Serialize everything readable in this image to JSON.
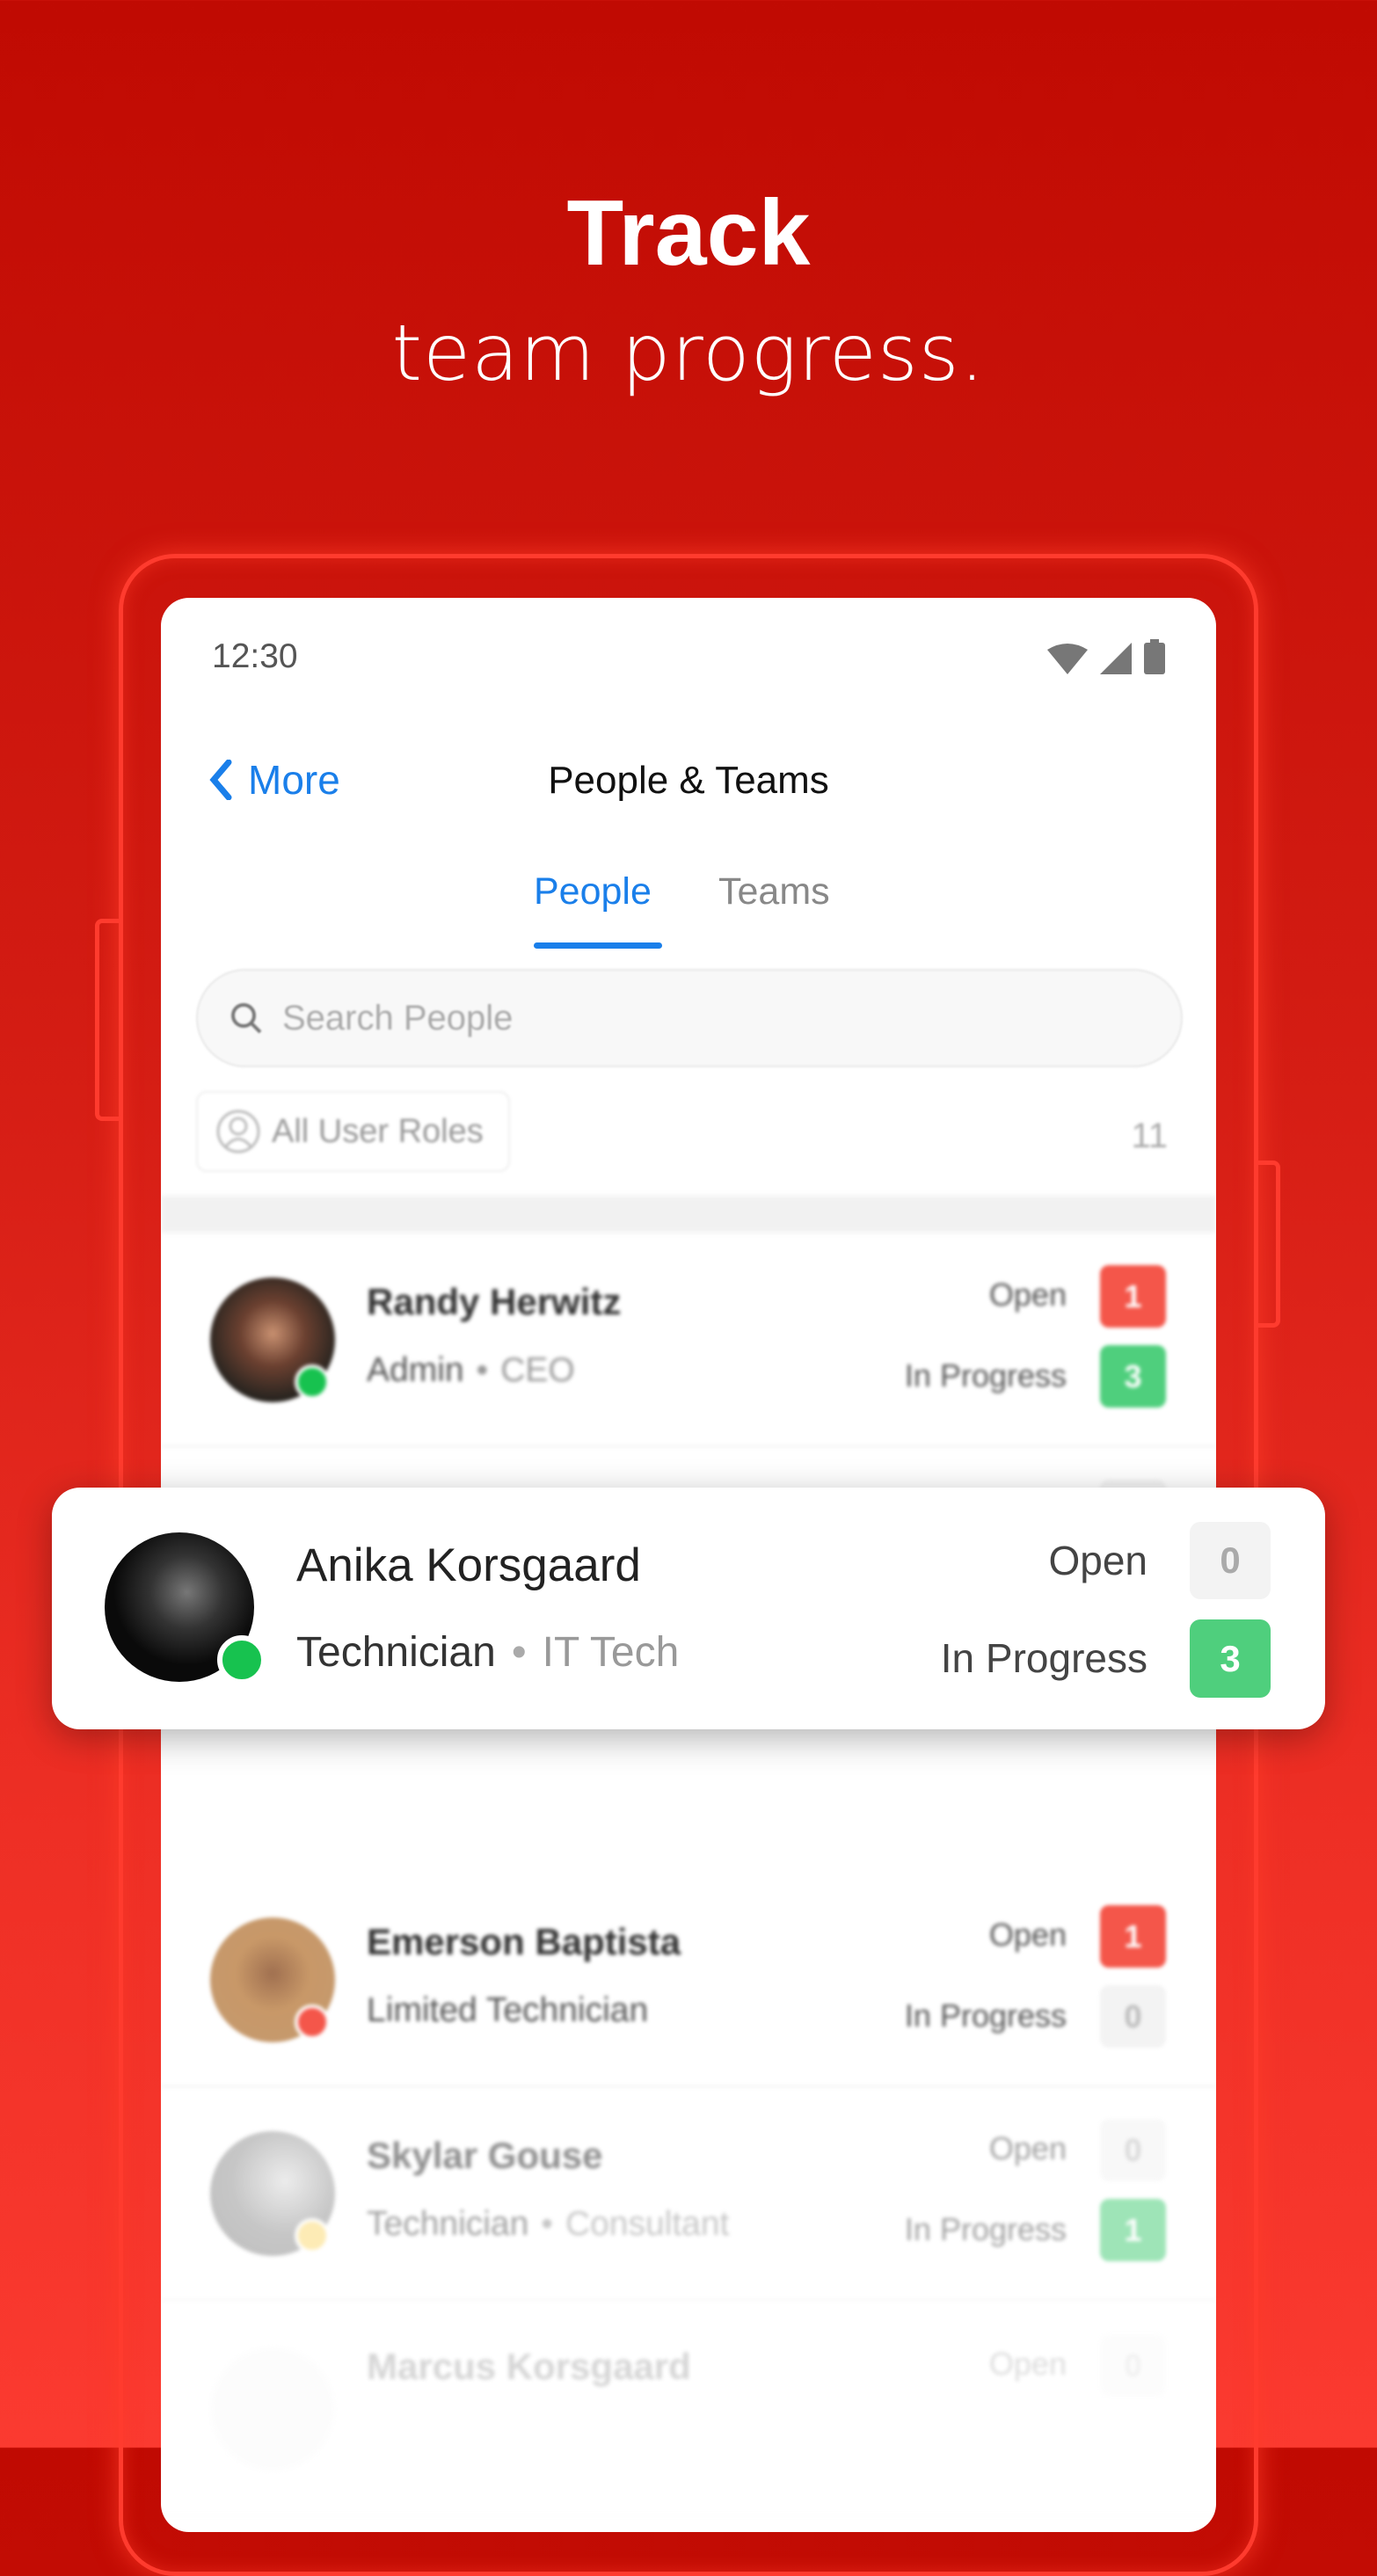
{
  "hero": {
    "title": "Track",
    "subtitle": "team progress."
  },
  "status_bar": {
    "time": "12:30",
    "icons": [
      "wifi-icon",
      "signal-icon",
      "battery-icon"
    ]
  },
  "nav": {
    "back_label": "More",
    "title": "People & Teams"
  },
  "tabs": [
    {
      "label": "People",
      "active": true
    },
    {
      "label": "Teams",
      "active": false
    }
  ],
  "search": {
    "placeholder": "Search People"
  },
  "filter": {
    "label": "All User Roles",
    "count": "11"
  },
  "colors": {
    "accent": "#1a7fea",
    "open_badge": "#f4564a",
    "progress_badge": "#4fcf7d",
    "empty_badge": "#f3f3f3",
    "online": "#17c24f",
    "busy": "#f4564a",
    "away": "#fddc7a"
  },
  "people": [
    {
      "name": "Randy Herwitz",
      "role": "Admin",
      "title": "CEO",
      "open_label": "Open",
      "open": "1",
      "progress_label": "In Progress",
      "in_progress": "3",
      "status": "online"
    },
    {
      "name": "Anika Korsgaard",
      "role": "Technician",
      "title": "IT Tech",
      "open_label": "Open",
      "open": "0",
      "progress_label": "In Progress",
      "in_progress": "3",
      "status": "online"
    },
    {
      "name": "Emerson Baptista",
      "role": "Limited Technician",
      "title": "",
      "open_label": "Open",
      "open": "1",
      "progress_label": "In Progress",
      "in_progress": "0",
      "status": "busy"
    },
    {
      "name": "Skylar Gouse",
      "role": "Technician",
      "title": "Consultant",
      "open_label": "Open",
      "open": "0",
      "progress_label": "In Progress",
      "in_progress": "1",
      "status": "away"
    },
    {
      "name": "Marcus Korsgaard",
      "role": "",
      "title": "",
      "open_label": "Open",
      "open": "0",
      "progress_label": "",
      "in_progress": "",
      "status": ""
    }
  ],
  "highlight": {
    "name": "Anika Korsgaard",
    "role": "Technician",
    "title": "IT Tech",
    "open_label": "Open",
    "open": "0",
    "progress_label": "In Progress",
    "in_progress": "3"
  }
}
